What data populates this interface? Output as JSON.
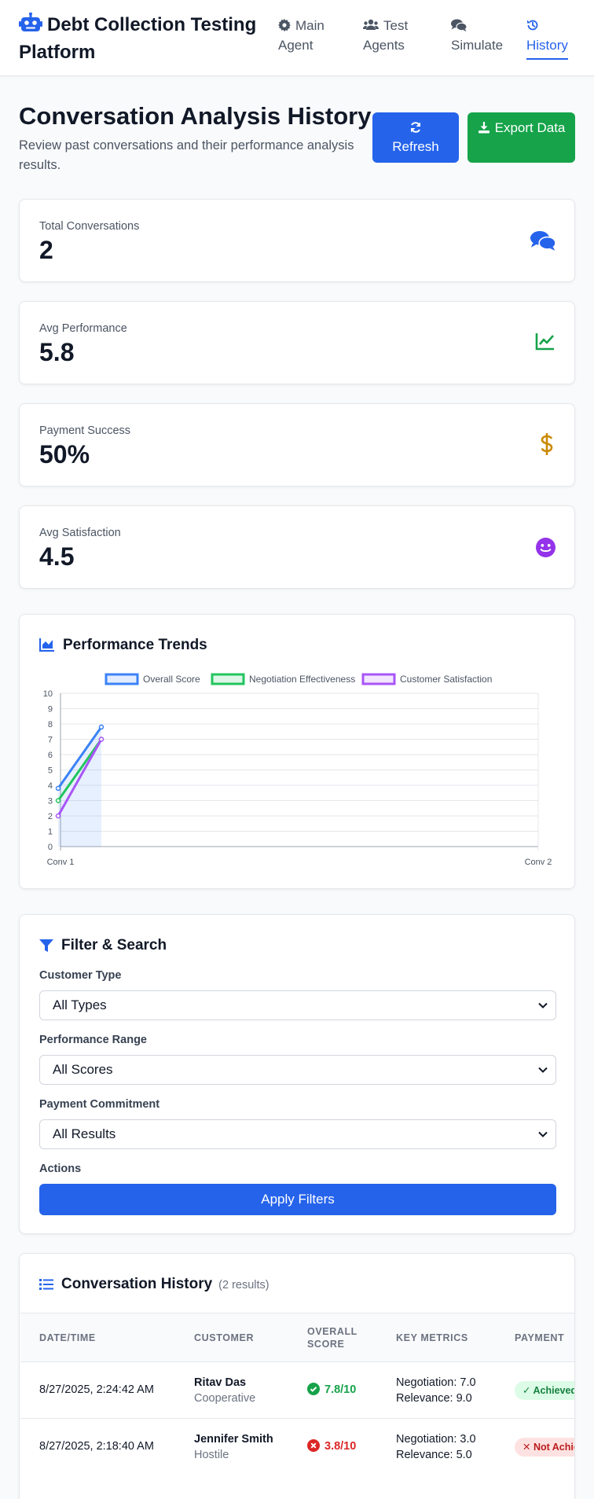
{
  "app": {
    "title": "Debt Collection Testing Platform",
    "nav": [
      {
        "label": "Main Agent",
        "icon": "gear-icon"
      },
      {
        "label": "Test Agents",
        "icon": "users-icon"
      },
      {
        "label": "Simulate",
        "icon": "comments-icon"
      },
      {
        "label": "History",
        "icon": "history-icon",
        "active": true
      }
    ]
  },
  "header": {
    "title": "Conversation Analysis History",
    "subtitle": "Review past conversations and their performance analysis results.",
    "refresh_label": "Refresh",
    "export_label": "Export Data"
  },
  "stats": [
    {
      "label": "Total Conversations",
      "value": "2",
      "icon": "comments-icon",
      "color": "#2563eb"
    },
    {
      "label": "Avg Performance",
      "value": "5.8",
      "icon": "line-chart-icon",
      "color": "#16a34a"
    },
    {
      "label": "Payment Success",
      "value": "50%",
      "icon": "dollar-icon",
      "color": "#ca8a04"
    },
    {
      "label": "Avg Satisfaction",
      "value": "4.5",
      "icon": "smile-icon",
      "color": "#9333ea"
    }
  ],
  "trends": {
    "title": "Performance Trends",
    "chart_data": {
      "type": "line",
      "x": [
        "Conv 1",
        "Conv 2"
      ],
      "ylim": [
        0,
        10
      ],
      "yticks": [
        "0",
        "1",
        "2",
        "3",
        "4",
        "5",
        "6",
        "7",
        "8",
        "9",
        "10"
      ],
      "grid": true,
      "legend_position": "top",
      "series": [
        {
          "name": "Overall Score",
          "values": [
            3.8,
            7.8
          ],
          "color": "#3b82f6",
          "fill": true
        },
        {
          "name": "Negotiation Effectiveness",
          "values": [
            3.0,
            7.0
          ],
          "color": "#22c55e"
        },
        {
          "name": "Customer Satisfaction",
          "values": [
            2.0,
            7.0
          ],
          "color": "#a855f7"
        }
      ]
    }
  },
  "filters": {
    "title": "Filter & Search",
    "customer_type_label": "Customer Type",
    "customer_type_value": "All Types",
    "performance_label": "Performance Range",
    "performance_value": "All Scores",
    "payment_label": "Payment Commitment",
    "payment_value": "All Results",
    "actions_label": "Actions",
    "apply_label": "Apply Filters"
  },
  "history": {
    "title": "Conversation History",
    "count": "(2 results)",
    "columns": {
      "datetime": "Date/Time",
      "customer": "Customer",
      "overall1": "Overall",
      "overall2": "Score",
      "metrics": "Key Metrics",
      "payment": "Payment"
    },
    "rows": [
      {
        "datetime": "8/27/2025, 2:24:42 AM",
        "name": "Ritav Das",
        "type": "Cooperative",
        "score": "7.8/10",
        "score_status": "good",
        "negotiation": "Negotiation: 7.0",
        "relevance": "Relevance: 9.0",
        "payment": "✓ Achieved",
        "payment_status": "achieved"
      },
      {
        "datetime": "8/27/2025, 2:18:40 AM",
        "name": "Jennifer Smith",
        "type": "Hostile",
        "score": "3.8/10",
        "score_status": "bad",
        "negotiation": "Negotiation: 3.0",
        "relevance": "Relevance: 5.0",
        "payment": "✕ Not Achieved",
        "payment_status": "not-achieved"
      }
    ]
  }
}
